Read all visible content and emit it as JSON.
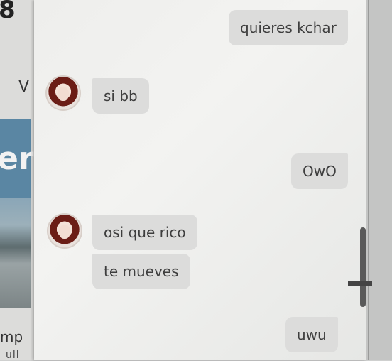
{
  "background_window": {
    "top_char": "8",
    "side_char": "V",
    "banner_text": "er",
    "bottom_text": "mp",
    "bottom_text_2": "ull"
  },
  "chat": {
    "messages": [
      {
        "side": "sent",
        "text": "quieres kchar"
      },
      {
        "side": "received",
        "text": "si bb"
      },
      {
        "side": "sent",
        "text": "OwO"
      },
      {
        "side": "received",
        "text": "osi que rico"
      },
      {
        "side": "received",
        "text": "te mueves"
      },
      {
        "side": "sent",
        "text": "uwu"
      }
    ]
  },
  "icons": {
    "avatar_1": "user-avatar-icon",
    "avatar_2": "user-avatar-icon"
  },
  "colors": {
    "bubble": "#dcdcdb",
    "chat_background": "#efefed",
    "text": "#3e3e3e"
  }
}
